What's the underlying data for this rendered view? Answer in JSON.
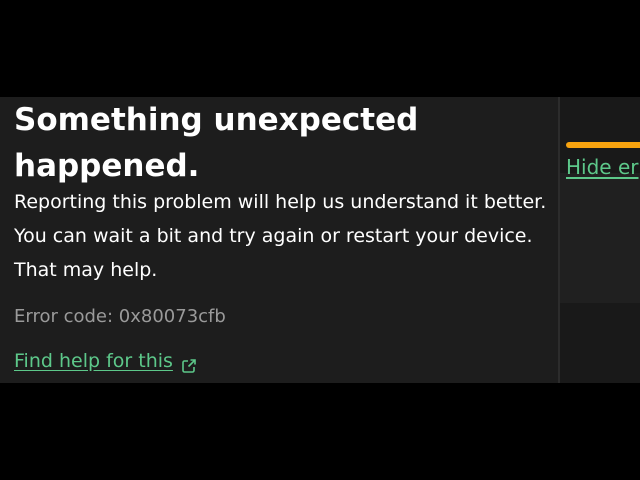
{
  "dialog": {
    "title": "Something unexpected happened.",
    "message": "Reporting this problem will help us understand it better. You can wait a bit and try again or restart your device. That may help.",
    "error_code": "Error code: 0x80073cfb",
    "help_link": "Find help for this",
    "help_link_icon": "external-link-icon"
  },
  "side_panel": {
    "link_text": "Hide er",
    "accent_color": "#f7a30f"
  },
  "colors": {
    "panel_background": "#1d1d1d",
    "link": "#5dc88a",
    "muted_text": "#9a9a9a"
  }
}
